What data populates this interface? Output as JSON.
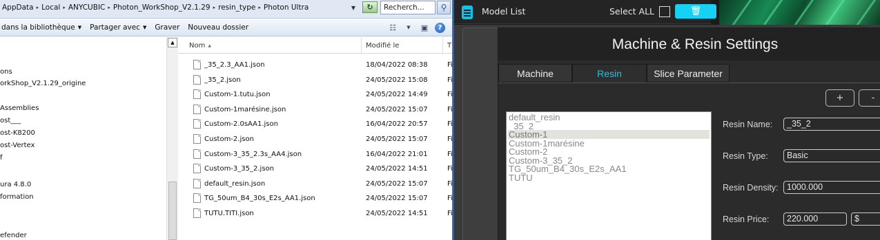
{
  "explorer": {
    "breadcrumb": [
      "AppData",
      "Local",
      "ANYCUBIC",
      "Photon_WorkShop_V2.1.29",
      "resin_type",
      "Photon Ultra"
    ],
    "search_placeholder": "Recherch...",
    "commands": [
      "dans la bibliothèque",
      "Partager avec",
      "Graver",
      "Nouveau dossier"
    ],
    "nav_items": [
      "ons",
      "orkShop_V2.1.29_origine",
      "Assemblies",
      "ost___",
      "ost-K8200",
      "ost-Vertex",
      "f",
      "ura 4.8.0",
      "formation",
      "efender"
    ],
    "columns": {
      "name": "Nom",
      "modified": "Modifié le",
      "type": "T"
    },
    "files": [
      {
        "name": "_35_2.3_AA1.json",
        "modified": "18/04/2022 08:38",
        "type": "Fi"
      },
      {
        "name": "_35_2.json",
        "modified": "24/05/2022 15:08",
        "type": "Fi"
      },
      {
        "name": "Custom-1.tutu.json",
        "modified": "24/05/2022 14:49",
        "type": "Fi"
      },
      {
        "name": "Custom-1marésine.json",
        "modified": "24/05/2022 15:07",
        "type": "Fi"
      },
      {
        "name": "Custom-2.0sAA1.json",
        "modified": "16/04/2022 20:57",
        "type": "Fi"
      },
      {
        "name": "Custom-2.json",
        "modified": "24/05/2022 15:07",
        "type": "Fi"
      },
      {
        "name": "Custom-3_35_2.3s_AA4.json",
        "modified": "16/04/2022 21:01",
        "type": "Fi"
      },
      {
        "name": "Custom-3_35_2.json",
        "modified": "24/05/2022 14:51",
        "type": "Fi"
      },
      {
        "name": "default_resin.json",
        "modified": "24/05/2022 15:07",
        "type": "Fi"
      },
      {
        "name": "TG_50um_B4_30s_E2s_AA1.json",
        "modified": "24/05/2022 15:07",
        "type": "Fi"
      },
      {
        "name": "TUTU.TITI.json",
        "modified": "24/05/2022 14:51",
        "type": "Fi"
      }
    ]
  },
  "app": {
    "model_list_title": "Model List",
    "select_all": "Select ALL",
    "accent_color": "#17d1f5",
    "dialog": {
      "title": "Machine & Resin Settings",
      "tabs": [
        "Machine",
        "Resin",
        "Slice Parameter"
      ],
      "active_tab": "Resin",
      "add_label": "+",
      "remove_label": "-",
      "resins": [
        "default_resin",
        "_35_2",
        "Custom-1",
        "Custom-1marésine",
        "Custom-2",
        "Custom-3_35_2",
        "TG_50um_B4_30s_E2s_AA1",
        "TUTU"
      ],
      "selected_resin": "Custom-1",
      "fields": {
        "name_label": "Resin Name:",
        "name_value": "_35_2",
        "type_label": "Resin Type:",
        "type_value": "Basic",
        "density_label": "Resin Density:",
        "density_value": "1000.000",
        "price_label": "Resin Price:",
        "price_value": "220.000",
        "currency": "$"
      }
    }
  }
}
